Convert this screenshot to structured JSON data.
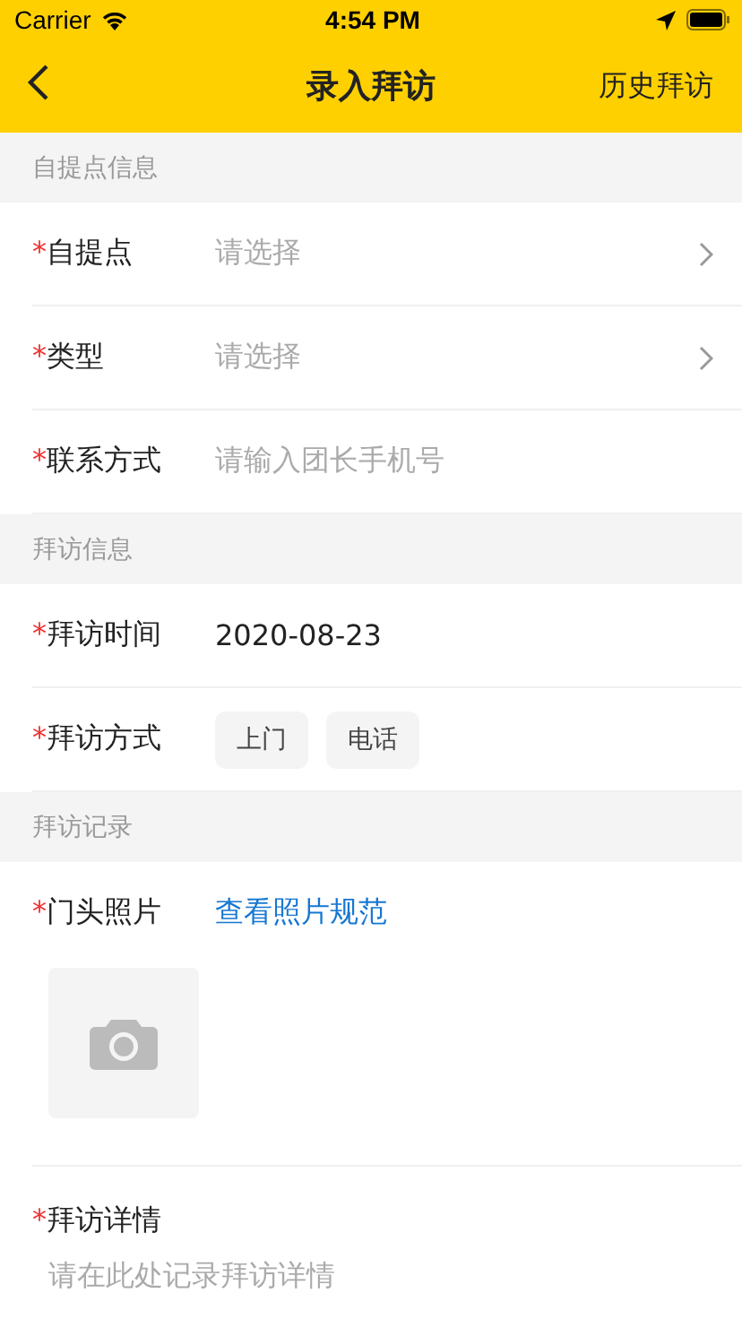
{
  "status_bar": {
    "carrier": "Carrier",
    "time": "4:54 PM"
  },
  "nav_bar": {
    "title": "录入拜访",
    "action": "历史拜访"
  },
  "sections": [
    {
      "title": "自提点信息",
      "fields": [
        {
          "kind": "select",
          "required_mark": "*",
          "label": "自提点",
          "placeholder": "请选择"
        },
        {
          "kind": "select",
          "required_mark": "*",
          "label": "类型",
          "placeholder": "请选择"
        },
        {
          "kind": "input",
          "required_mark": "*",
          "label": "联系方式",
          "placeholder": "请输入团长手机号"
        }
      ]
    },
    {
      "title": "拜访信息",
      "fields": [
        {
          "kind": "value",
          "required_mark": "*",
          "label": "拜访时间",
          "value": "2020-08-23"
        },
        {
          "kind": "choice",
          "required_mark": "*",
          "label": "拜访方式",
          "options": [
            {
              "label": "上门",
              "selected": false
            },
            {
              "label": "电话",
              "selected": false
            }
          ]
        }
      ]
    },
    {
      "title": "拜访记录",
      "fields": [
        {
          "kind": "photo",
          "required_mark": "*",
          "label": "门头照片",
          "link": "查看照片规范"
        },
        {
          "kind": "textarea",
          "required_mark": "*",
          "label": "拜访详情",
          "placeholder": "请在此处记录拜访详情"
        }
      ]
    }
  ]
}
